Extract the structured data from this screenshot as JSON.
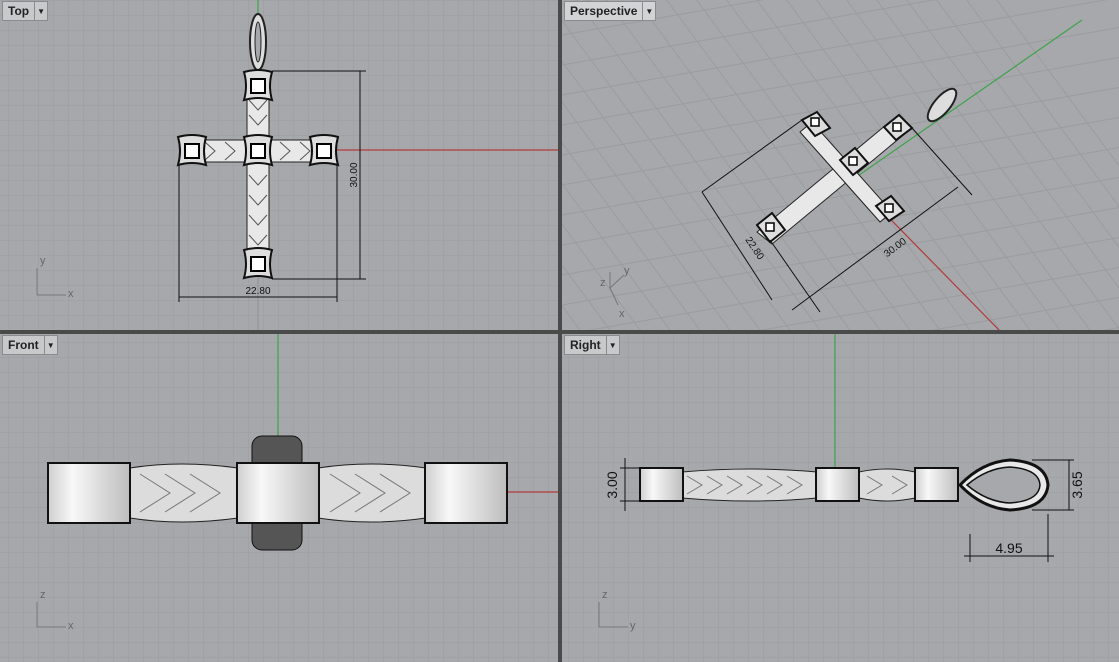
{
  "colors": {
    "grid_bg": "#a6a8ab",
    "grid_minor": "#9a9c9f",
    "grid_major": "#8e9093",
    "axis_x": "#b33a3a",
    "axis_y": "#3fa34d",
    "frame": "#4a4a4a"
  },
  "viewports": {
    "top": {
      "name": "Top",
      "axis_h": "x",
      "axis_v": "y",
      "dim_height": "30.00",
      "dim_width": "22.80"
    },
    "perspective": {
      "name": "Perspective",
      "axis_z": "z",
      "axis_y": "y",
      "axis_x": "x",
      "dim_a": "22.80",
      "dim_b": "30.00"
    },
    "front": {
      "name": "Front",
      "axis_h": "x",
      "axis_v": "z"
    },
    "right": {
      "name": "Right",
      "axis_h": "y",
      "axis_v": "z",
      "dim_left": "3.00",
      "dim_right": "3.65",
      "dim_bottom": "4.95"
    }
  },
  "icons": {
    "dropdown": "triangle-down-icon"
  }
}
